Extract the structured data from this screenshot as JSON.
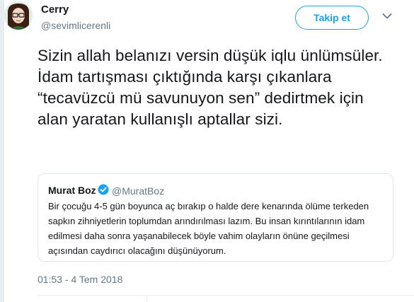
{
  "tweet": {
    "author_name": "Cerry",
    "author_handle": "@sevimlicerenli",
    "follow_label": "Takip et",
    "text": "Sizin allah belanızı versin düşük iqlu ünlümsüler. İdam tartışması çıktığında karşı çıkanlara “tecavüzcü mü savunuyon sen” dedirtmek için alan yaratan kullanışlı aptallar sizi.",
    "timestamp": "01:53 - 4 Tem 2018"
  },
  "quoted_tweet": {
    "author_name": "Murat Boz",
    "author_handle": "@MuratBoz",
    "verified": true,
    "text": "Bir çocuğu 4-5 gün boyunca aç bırakıp o halde dere kenarında ölüme terkeden sapkın zihniyetlerin toplumdan arındırılması lazım. Bu insan kırıntılarının idam edilmesi daha sonra yaşanabilecek böyle vahim olayların önüne geçilmesi açısından caydırıcı olacağını düşünüyorum."
  },
  "colors": {
    "accent": "#1da1f2",
    "secondary_text": "#657786",
    "primary_text": "#14171a",
    "border": "#e1e8ed"
  },
  "icons": {
    "more": "chevron-down-icon",
    "verified": "verified-badge-icon"
  }
}
